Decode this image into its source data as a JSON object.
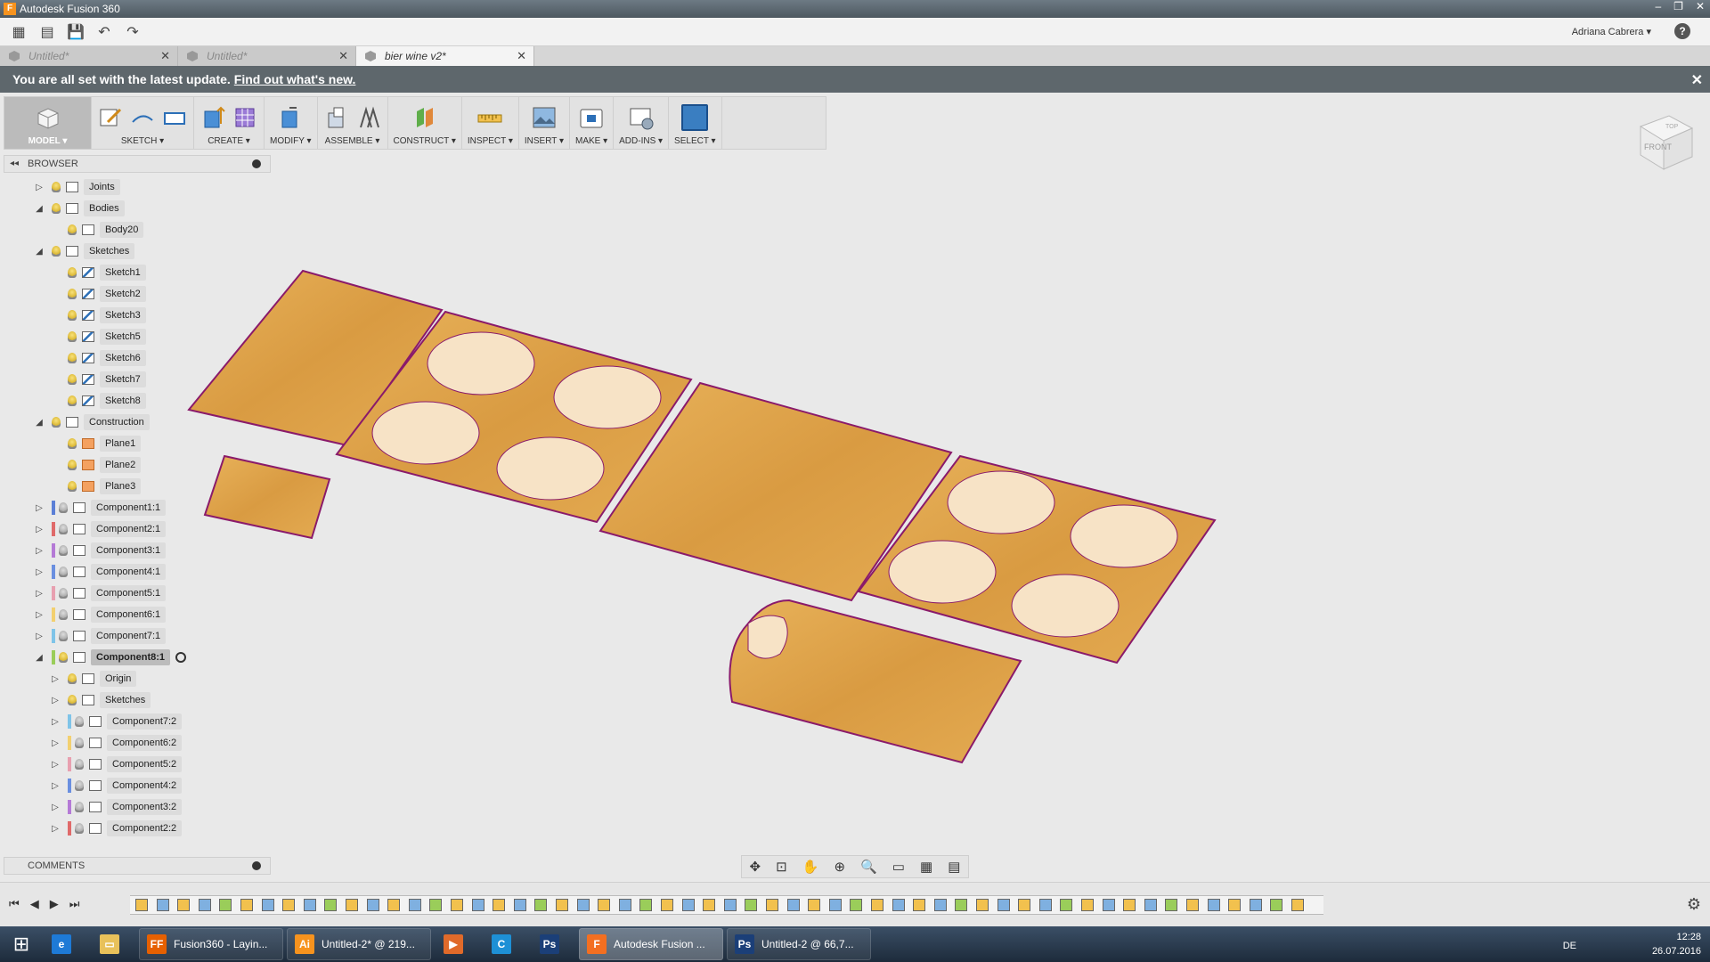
{
  "window": {
    "title": "Autodesk Fusion 360",
    "app_letter": "F"
  },
  "menubar": {
    "user": "Adriana Cabrera ▾",
    "help": "?"
  },
  "tabs": [
    {
      "label": "Untitled*",
      "active": false
    },
    {
      "label": "Untitled*",
      "active": false
    },
    {
      "label": "bier wine v2*",
      "active": true
    }
  ],
  "notice": {
    "text": "You are all set with the latest update.",
    "link": "Find out what's new."
  },
  "toolbar": {
    "model": "MODEL ▾",
    "sketch": "SKETCH ▾",
    "create": "CREATE ▾",
    "modify": "MODIFY ▾",
    "assemble": "ASSEMBLE ▾",
    "construct": "CONSTRUCT ▾",
    "inspect": "INSPECT ▾",
    "insert": "INSERT ▾",
    "make": "MAKE ▾",
    "addins": "ADD-INS ▾",
    "select": "SELECT ▾"
  },
  "viewcube": {
    "top": "TOP",
    "front": "FRONT"
  },
  "browser": {
    "title": "BROWSER",
    "items": [
      {
        "label": "Joints",
        "tri": "▷",
        "icon": "folder"
      },
      {
        "label": "Bodies",
        "tri": "◢",
        "icon": "folder"
      },
      {
        "label": "Body20",
        "tri": "",
        "icon": "body"
      },
      {
        "label": "Sketches",
        "tri": "◢",
        "icon": "folder"
      },
      {
        "label": "Sketch1",
        "tri": "",
        "icon": "sketch"
      },
      {
        "label": "Sketch2",
        "tri": "",
        "icon": "sketch"
      },
      {
        "label": "Sketch3",
        "tri": "",
        "icon": "sketch"
      },
      {
        "label": "Sketch5",
        "tri": "",
        "icon": "sketch"
      },
      {
        "label": "Sketch6",
        "tri": "",
        "icon": "sketch"
      },
      {
        "label": "Sketch7",
        "tri": "",
        "icon": "sketch"
      },
      {
        "label": "Sketch8",
        "tri": "",
        "icon": "sketch"
      },
      {
        "label": "Construction",
        "tri": "◢",
        "icon": "folder"
      },
      {
        "label": "Plane1",
        "tri": "",
        "icon": "plane"
      },
      {
        "label": "Plane2",
        "tri": "",
        "icon": "plane"
      },
      {
        "label": "Plane3",
        "tri": "",
        "icon": "plane"
      },
      {
        "label": "Component1:1",
        "tri": "▷",
        "icon": "component",
        "color": "#5b7fd6"
      },
      {
        "label": "Component2:1",
        "tri": "▷",
        "icon": "component",
        "color": "#e06a6a"
      },
      {
        "label": "Component3:1",
        "tri": "▷",
        "icon": "component",
        "color": "#b57ad6"
      },
      {
        "label": "Component4:1",
        "tri": "▷",
        "icon": "component",
        "color": "#6a8fe0"
      },
      {
        "label": "Component5:1",
        "tri": "▷",
        "icon": "component",
        "color": "#e8a0b0"
      },
      {
        "label": "Component6:1",
        "tri": "▷",
        "icon": "component",
        "color": "#f2d070"
      },
      {
        "label": "Component7:1",
        "tri": "▷",
        "icon": "component",
        "color": "#7fc4e8"
      },
      {
        "label": "Component8:1",
        "tri": "◢",
        "icon": "component",
        "color": "#9acd5a",
        "selected": true
      },
      {
        "label": "Origin",
        "tri": "▷",
        "icon": "folder"
      },
      {
        "label": "Sketches",
        "tri": "▷",
        "icon": "folder"
      },
      {
        "label": "Component7:2",
        "tri": "▷",
        "icon": "component",
        "color": "#7fc4e8"
      },
      {
        "label": "Component6:2",
        "tri": "▷",
        "icon": "component",
        "color": "#f2d070"
      },
      {
        "label": "Component5:2",
        "tri": "▷",
        "icon": "component",
        "color": "#e8a0b0"
      },
      {
        "label": "Component4:2",
        "tri": "▷",
        "icon": "component",
        "color": "#6a8fe0"
      },
      {
        "label": "Component3:2",
        "tri": "▷",
        "icon": "component",
        "color": "#b57ad6"
      },
      {
        "label": "Component2:2",
        "tri": "▷",
        "icon": "component",
        "color": "#e06a6a"
      }
    ]
  },
  "comments": {
    "title": "COMMENTS"
  },
  "taskbar": {
    "windows": [
      {
        "label": "Fusion360 - Layin...",
        "badge": "FF",
        "color": "#e66000",
        "active": false
      },
      {
        "label": "Untitled-2* @ 219...",
        "badge": "Ai",
        "color": "#f7931e",
        "active": false
      },
      {
        "label": "Autodesk Fusion ...",
        "badge": "F",
        "color": "#f36f21",
        "active": true
      },
      {
        "label": "Untitled-2 @ 66,7...",
        "badge": "Ps",
        "color": "#1b3f78",
        "active": false
      }
    ],
    "lang": "DE",
    "time": "12:28",
    "date": "26.07.2016"
  }
}
